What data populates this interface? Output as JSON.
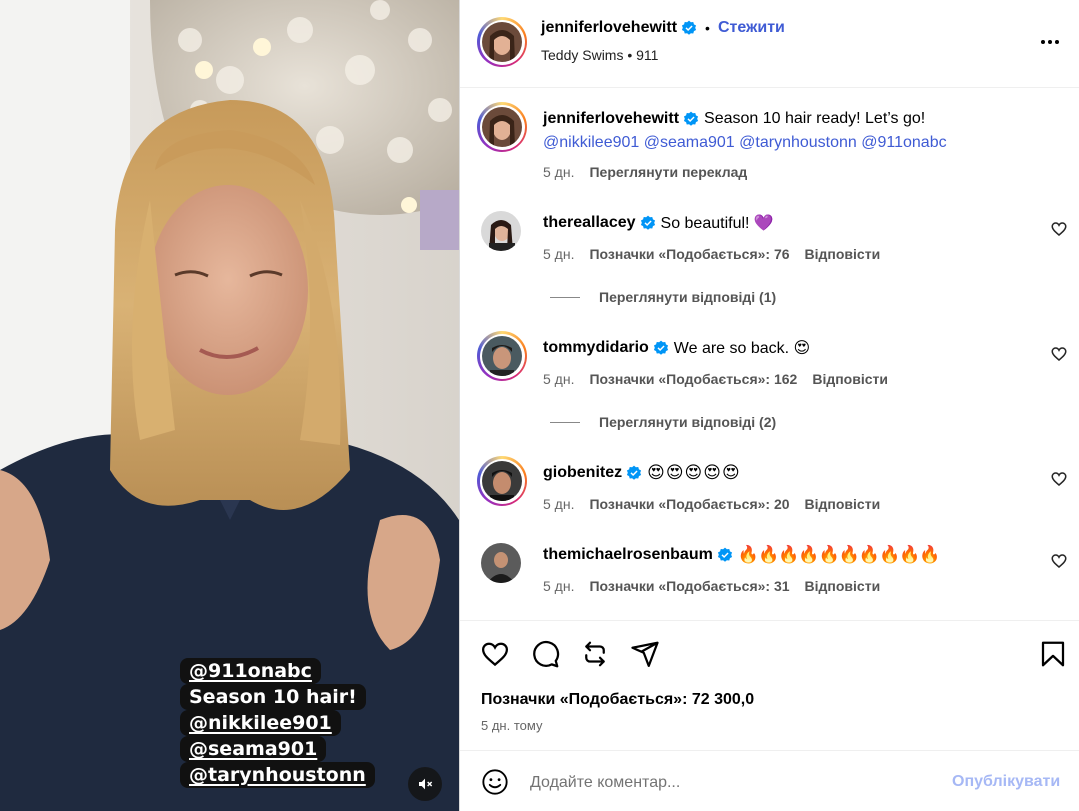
{
  "post": {
    "author": "jenniferlovehewitt",
    "follow_label": "Стежити",
    "separator_dot": "•",
    "audio": "Teddy Swims • 911",
    "caption": "Season 10 hair ready! Let’s go!",
    "caption_mentions": "@nikkilee901 @seama901 @tarynhoustonn @911onabc",
    "caption_age": "5 дн.",
    "translate_label": "Переглянути переклад"
  },
  "media": {
    "sticker_lines": [
      "@911onabc",
      "Season 10 hair!",
      "@nikkilee901",
      "@seama901",
      "@tarynhoustonn"
    ]
  },
  "comments": [
    {
      "user": "thereallacey",
      "text": "So beautiful! 💜",
      "age": "5 дн.",
      "likes": "Позначки «Подобається»: 76",
      "reply": "Відповісти",
      "view_replies": "Переглянути відповіді (1)"
    },
    {
      "user": "tommydidario",
      "text": "We are so back. 😍",
      "age": "5 дн.",
      "likes": "Позначки «Подобається»: 162",
      "reply": "Відповісти",
      "view_replies": "Переглянути відповіді (2)"
    },
    {
      "user": "giobenitez",
      "text": "😍😍😍😍😍",
      "age": "5 дн.",
      "likes": "Позначки «Подобається»: 20",
      "reply": "Відповісти"
    },
    {
      "user": "themichaelrosenbaum",
      "text": "🔥🔥🔥🔥🔥🔥🔥🔥🔥🔥",
      "age": "5 дн.",
      "likes": "Позначки «Подобається»: 31",
      "reply": "Відповісти"
    }
  ],
  "footer": {
    "likes_total": "Позначки «Подобається»: 72 300,0",
    "posted_ago": "5 дн. тому",
    "comment_placeholder": "Додайте коментар...",
    "post_label": "Опублікувати"
  },
  "colors": {
    "link": "#3f5bd4",
    "verified": "#0095f6",
    "post_disabled": "#a6b8f5"
  },
  "icons": [
    "verified-badge-icon",
    "more-options-icon",
    "heart-icon",
    "comment-icon",
    "repost-icon",
    "share-icon",
    "bookmark-icon",
    "emoji-icon",
    "mute-icon"
  ]
}
